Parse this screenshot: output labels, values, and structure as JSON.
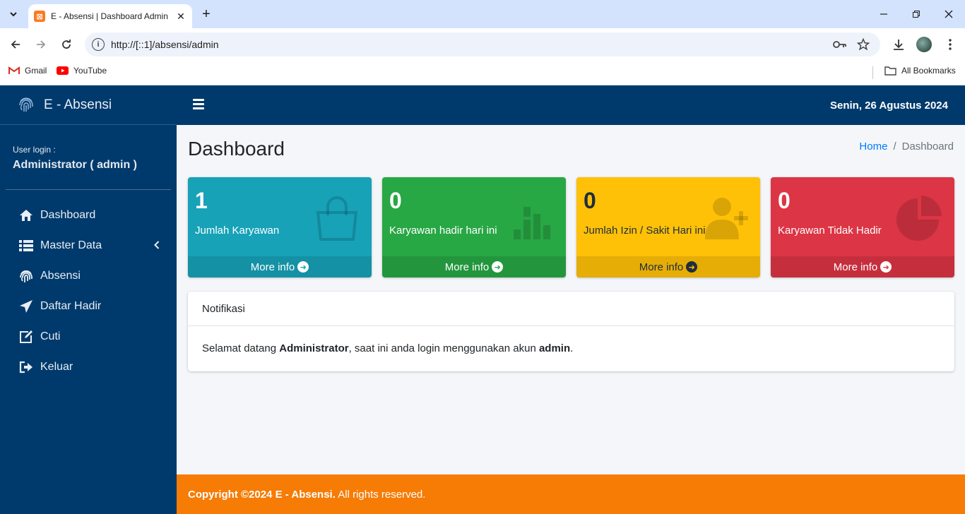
{
  "browser": {
    "tab_title": "E - Absensi | Dashboard Admin",
    "url": "http://[::1]/absensi/admin",
    "bookmarks": [
      {
        "label": "Gmail",
        "icon": "gmail-icon"
      },
      {
        "label": "YouTube",
        "icon": "youtube-icon"
      }
    ],
    "all_bookmarks_label": "All Bookmarks"
  },
  "sidebar": {
    "brand": "E - Absensi",
    "user_label": "User login :",
    "user_name": "Administrator ( admin )",
    "items": [
      {
        "label": "Dashboard",
        "icon": "home-icon"
      },
      {
        "label": "Master Data",
        "icon": "list-icon"
      },
      {
        "label": "Absensi",
        "icon": "fingerprint-icon"
      },
      {
        "label": "Daftar Hadir",
        "icon": "paper-plane-icon"
      },
      {
        "label": "Cuti",
        "icon": "edit-icon"
      },
      {
        "label": "Keluar",
        "icon": "sign-out-icon"
      }
    ]
  },
  "topnav": {
    "date": "Senin, 26 Agustus 2024"
  },
  "page": {
    "title": "Dashboard",
    "breadcrumb": [
      "Home",
      "Dashboard"
    ]
  },
  "stats": [
    {
      "value": "1",
      "label": "Jumlah Karyawan",
      "footer": "More info",
      "color": "#17a2b8",
      "icon": "shopping-bag-icon"
    },
    {
      "value": "0",
      "label": "Karyawan hadir hari ini",
      "footer": "More info",
      "color": "#28a745",
      "icon": "bar-chart-icon"
    },
    {
      "value": "0",
      "label": "Jumlah Izin / Sakit Hari ini",
      "footer": "More info",
      "color": "#ffc107",
      "icon": "user-plus-icon"
    },
    {
      "value": "0",
      "label": "Karyawan Tidak Hadir",
      "footer": "More info",
      "color": "#dc3545",
      "icon": "pie-chart-icon"
    }
  ],
  "notification": {
    "header": "Notifikasi",
    "text_1": "Selamat datang ",
    "name": "Administrator",
    "text_2": ", saat ini anda login menggunakan akun ",
    "account": "admin",
    "text_3": "."
  },
  "footer": {
    "copyright": "Copyright ©2024 E - Absensi.",
    "rights": " All rights reserved."
  }
}
